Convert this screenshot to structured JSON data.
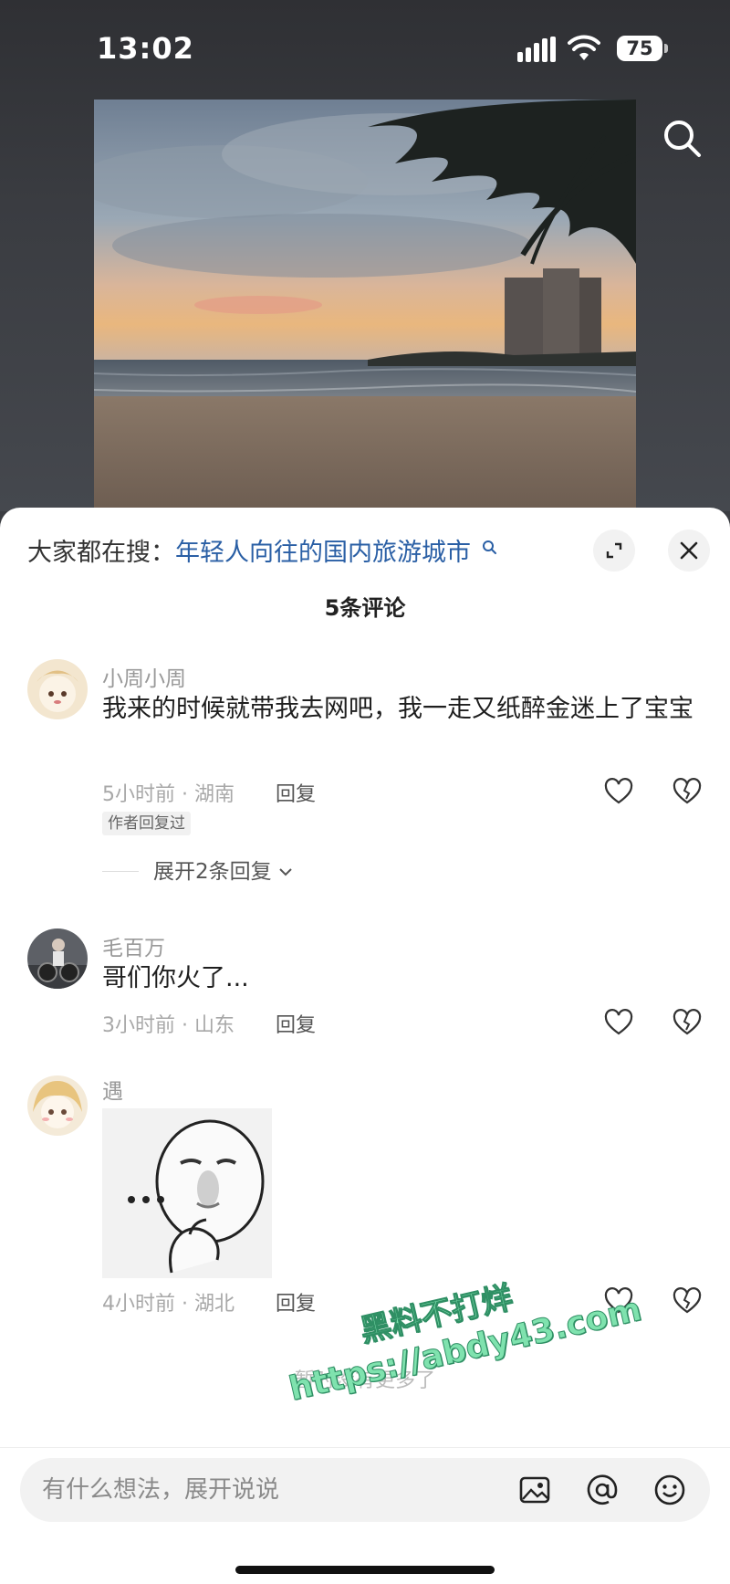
{
  "status_bar": {
    "time": "13:02",
    "battery": "75"
  },
  "icons": {
    "signal": "signal-bars-icon",
    "wifi": "wifi-icon",
    "search": "search-icon",
    "expand": "expand-icon",
    "close": "close-icon",
    "like": "heart-icon",
    "dislike": "broken-heart-icon",
    "image": "image-icon",
    "at": "at-icon",
    "emoji": "emoji-icon"
  },
  "hot_search": {
    "label": "大家都在搜：",
    "query": "年轻人向往的国内旅游城市"
  },
  "comments_header": {
    "count_text": "5条评论"
  },
  "comments": [
    {
      "username": "小周小周",
      "text": "我来的时候就带我去网吧，我一走又纸醉金迷上了宝宝",
      "meta": "5小时前 · 湖南",
      "reply_label": "回复",
      "author_tag": "作者回复过",
      "expand_replies": "展开2条回复"
    },
    {
      "username": "毛百万",
      "text": "哥们你火了...",
      "meta": "3小时前 · 山东",
      "reply_label": "回复"
    },
    {
      "username": "遇",
      "meta": "4小时前 · 湖北",
      "reply_label": "回复"
    }
  ],
  "end_text": "暂时没有更多了",
  "watermark": {
    "line1": "黑料不打烊",
    "line2": "https://abdy43.com"
  },
  "input_bar": {
    "placeholder": "有什么想法，展开说说"
  },
  "colors": {
    "link_blue": "#2a5fa5",
    "watermark_green": "#7fe2ae"
  }
}
